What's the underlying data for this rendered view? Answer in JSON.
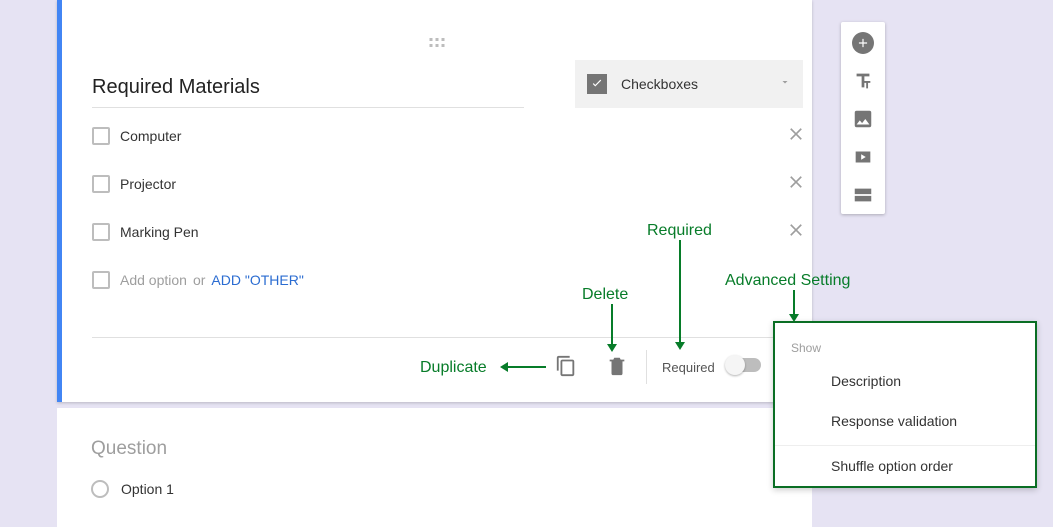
{
  "question1": {
    "title": "Required Materials",
    "type_label": "Checkboxes",
    "options": [
      "Computer",
      "Projector",
      "Marking Pen"
    ],
    "add_option_placeholder": "Add option",
    "add_option_or": "or",
    "add_other_label": "ADD \"OTHER\"",
    "required_label": "Required"
  },
  "question2": {
    "title": "Question",
    "option1": "Option 1"
  },
  "advanced_menu": {
    "section_label": "Show",
    "items": [
      "Description",
      "Response validation",
      "Shuffle option order"
    ]
  },
  "annotations": {
    "duplicate": "Duplicate",
    "delete": "Delete",
    "required": "Required",
    "advanced": "Advanced Setting"
  }
}
